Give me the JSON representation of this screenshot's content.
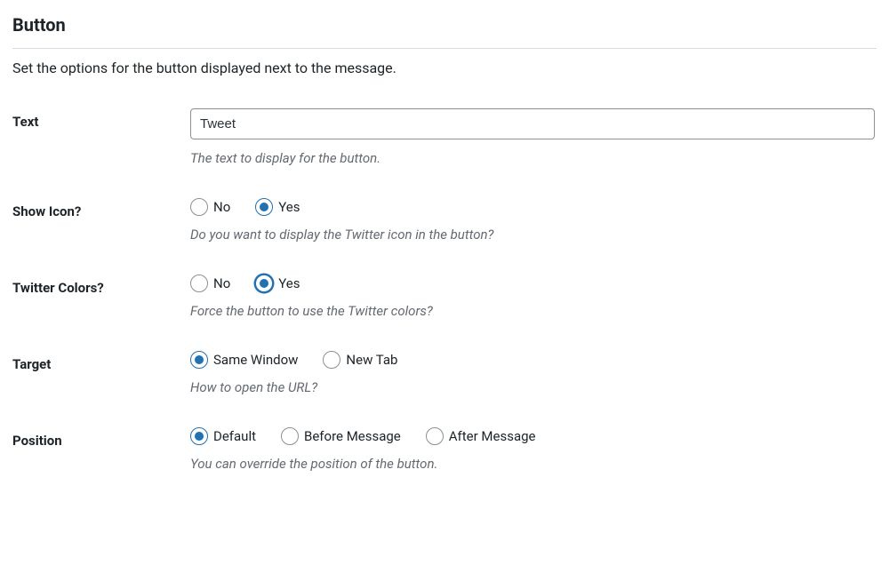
{
  "section": {
    "title": "Button",
    "description": "Set the options for the button displayed next to the message."
  },
  "fields": {
    "text": {
      "label": "Text",
      "value": "Tweet",
      "help": "The text to display for the button."
    },
    "show_icon": {
      "label": "Show Icon?",
      "options": {
        "no": "No",
        "yes": "Yes"
      },
      "help": "Do you want to display the Twitter icon in the button?"
    },
    "twitter_colors": {
      "label": "Twitter Colors?",
      "options": {
        "no": "No",
        "yes": "Yes"
      },
      "help": "Force the button to use the Twitter colors?"
    },
    "target": {
      "label": "Target",
      "options": {
        "same_window": "Same Window",
        "new_tab": "New Tab"
      },
      "help": "How to open the URL?"
    },
    "position": {
      "label": "Position",
      "options": {
        "default": "Default",
        "before": "Before Message",
        "after": "After Message"
      },
      "help": "You can override the position of the button."
    }
  }
}
